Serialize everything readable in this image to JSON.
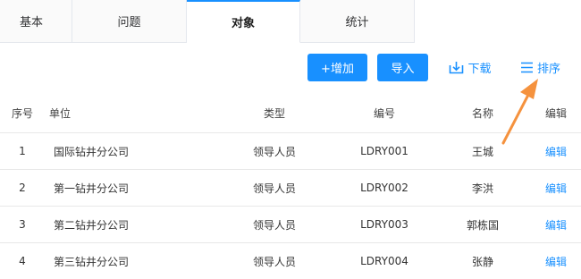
{
  "tabs": [
    {
      "label": "基本",
      "active": false
    },
    {
      "label": "问题",
      "active": false
    },
    {
      "label": "对象",
      "active": true
    },
    {
      "label": "统计",
      "active": false
    }
  ],
  "toolbar": {
    "add_label": "+增加",
    "import_label": "导入",
    "download_label": "下载",
    "download_icon": "download-icon",
    "sort_label": "排序",
    "sort_icon": "menu-lines-icon"
  },
  "table": {
    "headers": [
      "序号",
      "单位",
      "类型",
      "编号",
      "名称",
      "编辑"
    ],
    "rows": [
      {
        "index": "1",
        "unit": "国际钻井分公司",
        "type": "领导人员",
        "code": "LDRY001",
        "name": "王城",
        "action": "编辑"
      },
      {
        "index": "2",
        "unit": "第一钻井分公司",
        "type": "领导人员",
        "code": "LDRY002",
        "name": "李洪",
        "action": "编辑"
      },
      {
        "index": "3",
        "unit": "第二钻井分公司",
        "type": "领导人员",
        "code": "LDRY003",
        "name": "郭栋国",
        "action": "编辑"
      },
      {
        "index": "4",
        "unit": "第三钻井分公司",
        "type": "领导人员",
        "code": "LDRY004",
        "name": "张静",
        "action": "编辑"
      }
    ]
  },
  "colors": {
    "accent": "#1890ff",
    "annotation_arrow": "#f5923e",
    "grid": "#e8e8e8"
  }
}
